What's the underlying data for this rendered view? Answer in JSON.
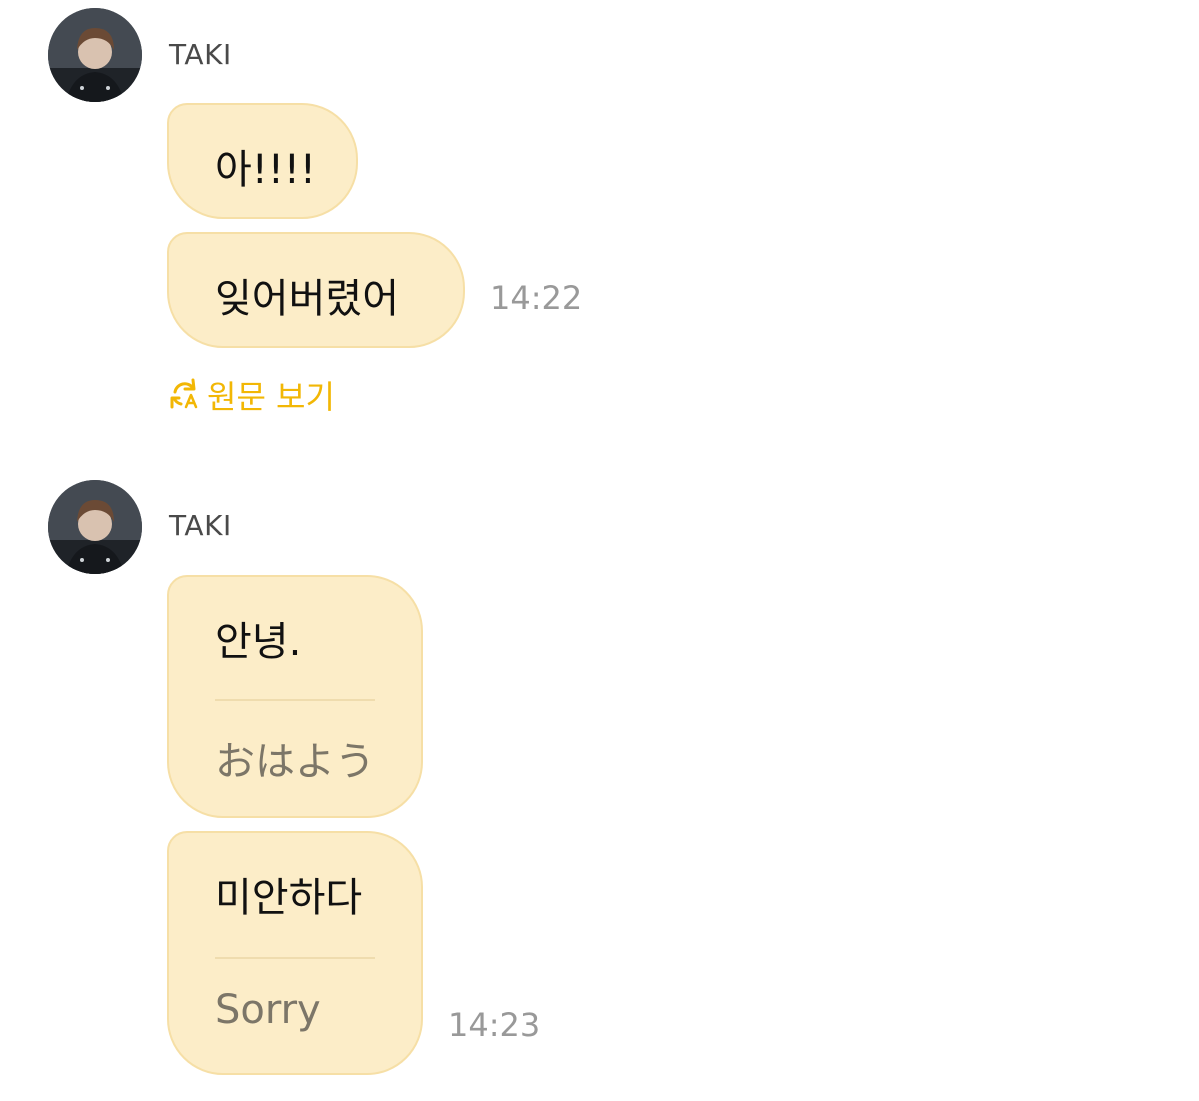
{
  "messages": [
    {
      "sender": "TAKI",
      "bubbles": [
        {
          "text": "아!!!!"
        },
        {
          "text": "잊어버렸어"
        }
      ],
      "time": "14:22",
      "translation_toggle": {
        "label": "원문 보기",
        "icon": "translate-refresh-icon"
      }
    },
    {
      "sender": "TAKI",
      "bubbles": [
        {
          "text": "안녕.",
          "translation": "おはよう"
        },
        {
          "text": "미안하다",
          "translation": "Sorry"
        }
      ],
      "time": "14:23"
    }
  ],
  "colors": {
    "bubble": "#fcedc8",
    "bubble_border": "#f6dfa6",
    "accent": "#f2b705",
    "time": "#999999"
  }
}
